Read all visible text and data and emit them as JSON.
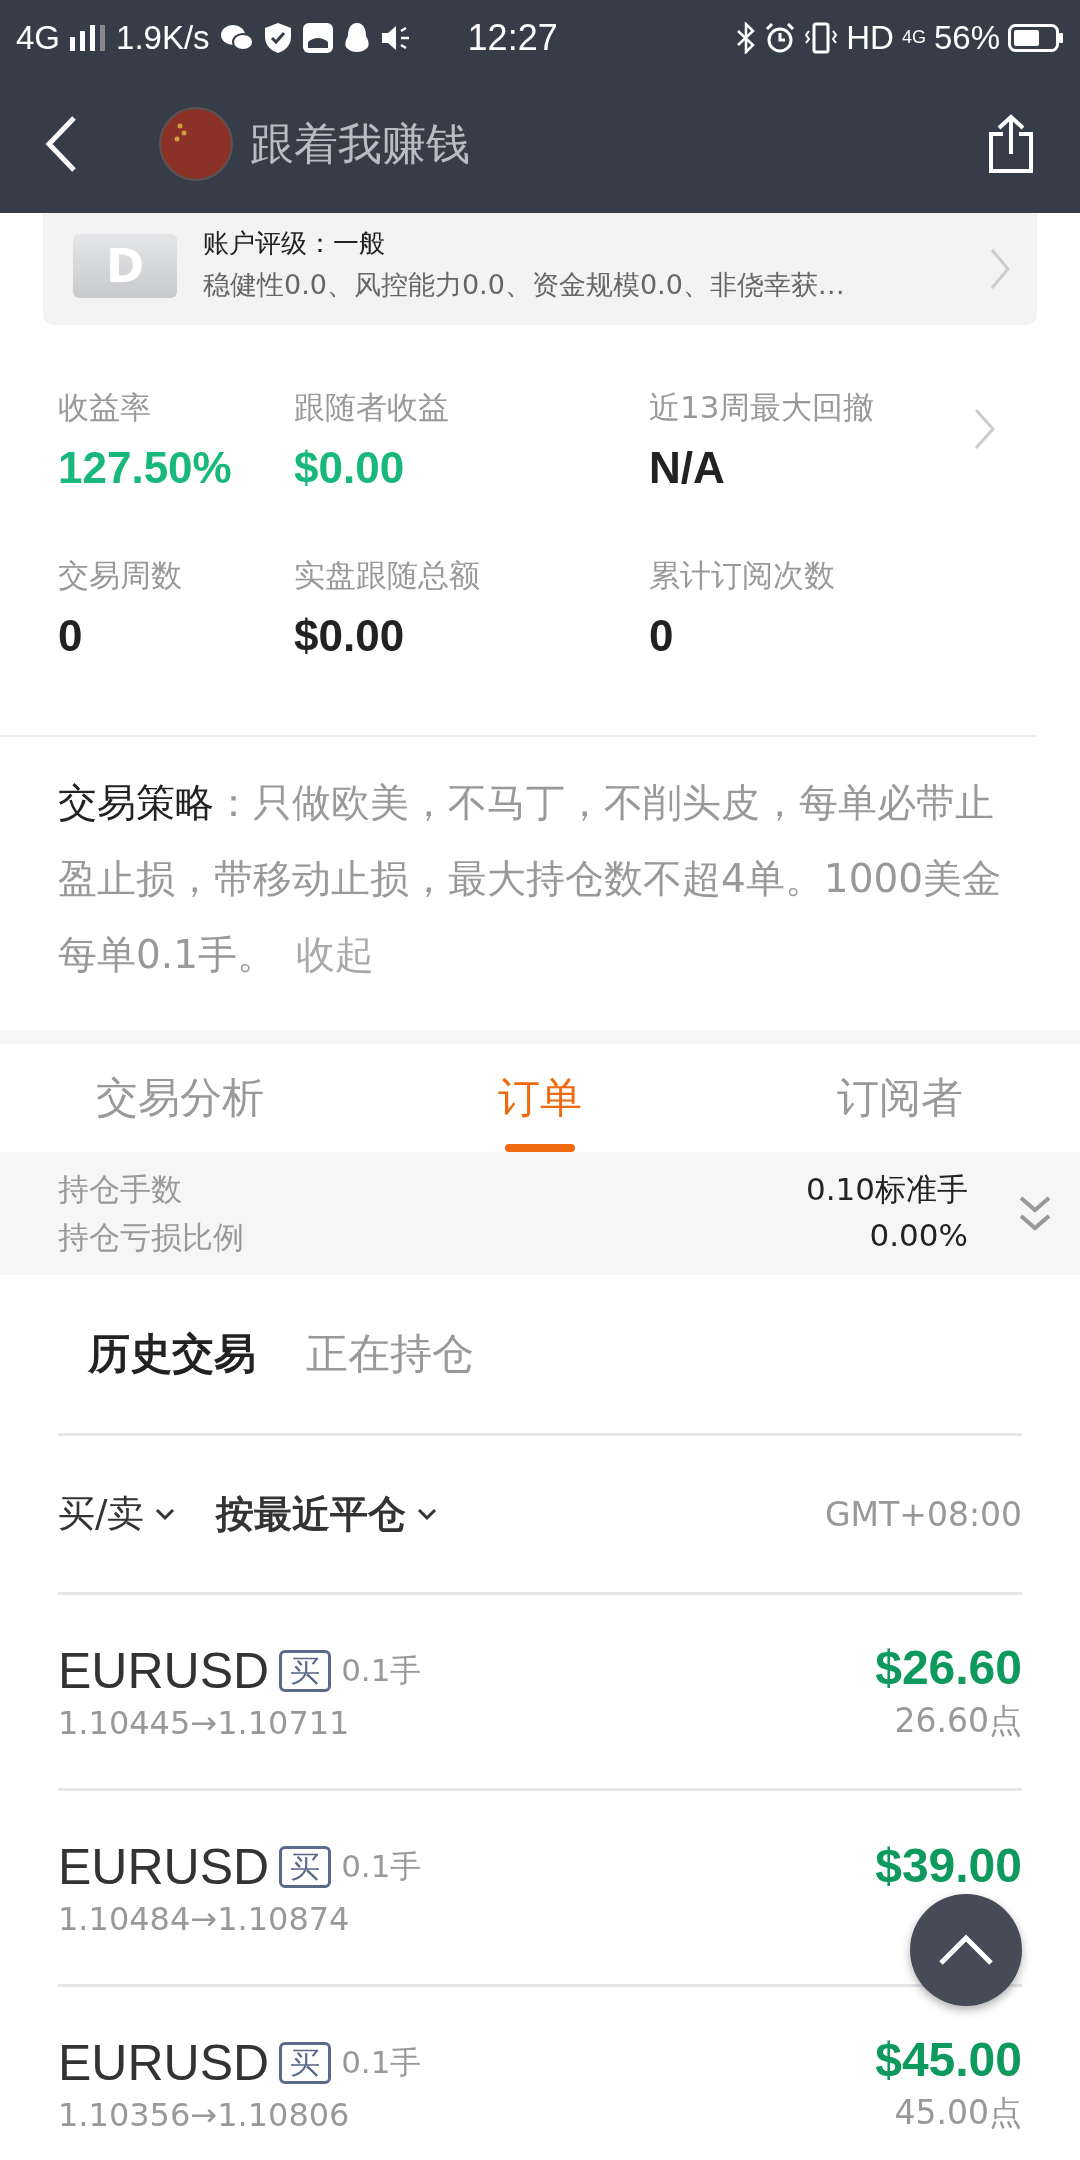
{
  "status_bar": {
    "network": "4G",
    "speed": "1.9K/s",
    "time": "12:27",
    "hd": "HD",
    "network_right": "4G",
    "battery": "56%"
  },
  "header": {
    "title": "跟着我赚钱"
  },
  "rating_card": {
    "badge": "D",
    "title": "账户评级：一般",
    "detail": "稳健性0.0、风控能力0.0、资金规模0.0、非侥幸获…"
  },
  "stats": [
    {
      "label": "收益率",
      "value": "127.50%",
      "positive": true
    },
    {
      "label": "跟随者收益",
      "value": "$0.00",
      "positive": true
    },
    {
      "label": "近13周最大回撤",
      "value": "N/A",
      "positive": false
    },
    {
      "label": "交易周数",
      "value": "0",
      "positive": false
    },
    {
      "label": "实盘跟随总额",
      "value": "$0.00",
      "positive": false
    },
    {
      "label": "累计订阅次数",
      "value": "0",
      "positive": false
    }
  ],
  "strategy": {
    "text": "**交易策略**：只做欧美，不马丁，不削头皮，每单必带止盈止损，带移动止损，最大持仓数不超4单。1000美金每单0.1手。",
    "toggle": "收起"
  },
  "tabs": [
    {
      "label": "交易分析",
      "selected": false
    },
    {
      "label": "订单",
      "selected": true
    },
    {
      "label": "订阅者",
      "selected": false
    }
  ],
  "summary": [
    {
      "label": "持仓手数",
      "value": "0.10标准手"
    },
    {
      "label": "持仓亏损比例",
      "value": "0.00%"
    }
  ],
  "subtabs": [
    {
      "label": "历史交易",
      "selected": true
    },
    {
      "label": "正在持仓",
      "selected": false
    }
  ],
  "filters": [
    {
      "label": "买/卖"
    },
    {
      "label": "按最近平仓"
    }
  ],
  "timezone": "GMT+08:00",
  "orders": [
    {
      "symbol": "EURUSD",
      "side": "买",
      "lots": "0.1手",
      "prices": "1.10445→1.10711",
      "profit": "$26.60",
      "points": "26.60点"
    },
    {
      "symbol": "EURUSD",
      "side": "买",
      "lots": "0.1手",
      "prices": "1.10484→1.10874",
      "profit": "$39.00"
    },
    {
      "symbol": "EURUSD",
      "side": "买",
      "lots": "0.1手",
      "prices": "1.10356→1.10806",
      "profit": "$45.00",
      "points": "45.00点"
    }
  ]
}
